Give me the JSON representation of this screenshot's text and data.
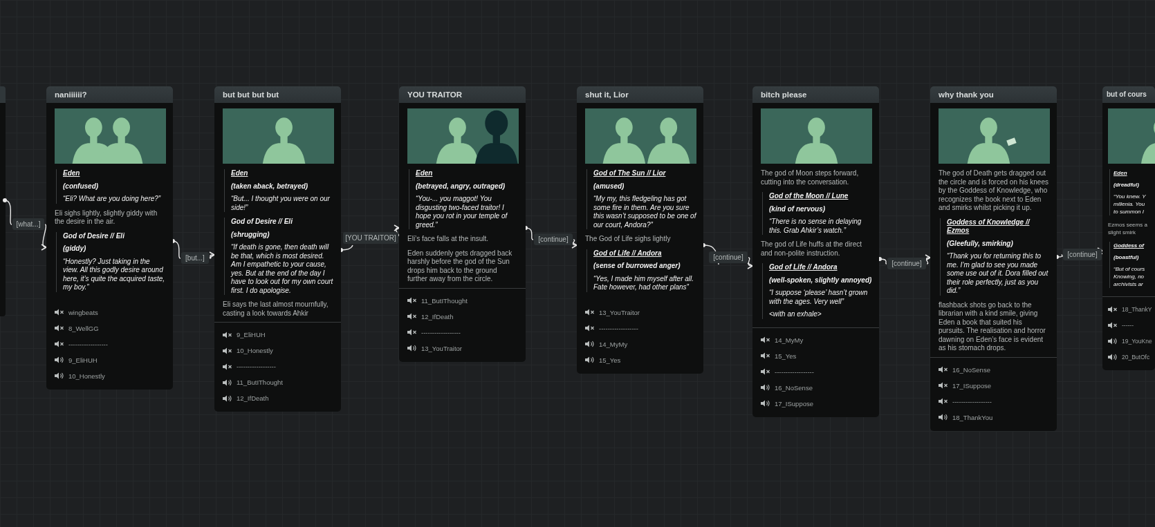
{
  "edges": [
    {
      "label": "[what...]"
    },
    {
      "label": "[but...]"
    },
    {
      "label": "[YOU TRAITOR]"
    },
    {
      "label": "[continue]"
    },
    {
      "label": "[continue]"
    },
    {
      "label": "[continue]"
    },
    {
      "label": "[continue]"
    }
  ],
  "cards": [
    {
      "title": "naniiiiii?",
      "image": {
        "kind": "picture"
      },
      "divider": false,
      "blocks": [
        {
          "kind": "dialogue",
          "speaker": "Eden",
          "underlined": true,
          "emotion": "(confused)",
          "lines": [
            "“Eli? What are you doing here?”"
          ]
        },
        {
          "kind": "narration",
          "lines": [
            "Eli sighs lightly, slightly giddy with the desire in the air."
          ]
        },
        {
          "kind": "dialogue",
          "speaker": "God of Desire // Eli",
          "underlined": false,
          "emotion": "(giddy)",
          "lines": [
            "“Honestly? Just taking in the view. All this godly desire around here, it’s quite the acquired taste, my boy.”"
          ]
        }
      ],
      "audio": [
        {
          "name": "wingbeats",
          "muted": true
        },
        {
          "name": "8_WellGG",
          "muted": true
        },
        {
          "name": "------------------",
          "muted": true
        },
        {
          "name": "9_EliHUH",
          "muted": false
        },
        {
          "name": "10_Honestly",
          "muted": false
        }
      ]
    },
    {
      "title": "but but but but",
      "image": {
        "kind": "picture"
      },
      "divider": true,
      "blocks": [
        {
          "kind": "dialogue",
          "speaker": "Eden",
          "underlined": true,
          "emotion": "(taken aback, betrayed)",
          "lines": [
            "“But... I thought you were on our side!”"
          ]
        },
        {
          "kind": "dialogue",
          "speaker": "God of Desire // Eli",
          "underlined": false,
          "emotion": "(shrugging)",
          "lines": [
            "“If death is gone, then death will be that, which is most desired. Am I empathetic to your cause, yes. But at the end of the day I have to look out for my own court first. I do apologise."
          ]
        },
        {
          "kind": "narration",
          "lines": [
            "Eli says the last almost mournfully, casting a look towards Ahkir"
          ]
        }
      ],
      "audio": [
        {
          "name": "9_EliHUH",
          "muted": true
        },
        {
          "name": "10_Honestly",
          "muted": true
        },
        {
          "name": "------------------",
          "muted": true
        },
        {
          "name": "11_ButIThought",
          "muted": false
        },
        {
          "name": "12_IfDeath",
          "muted": false
        }
      ]
    },
    {
      "title": "YOU TRAITOR",
      "image": {
        "kind": "picture"
      },
      "divider": true,
      "blocks": [
        {
          "kind": "dialogue",
          "speaker": "Eden",
          "underlined": true,
          "emotion": "(betrayed, angry, outraged)",
          "lines": [
            "“You-... you maggot! You disgusting two-faced traitor! I hope you rot in your temple of greed.”"
          ]
        },
        {
          "kind": "narration",
          "lines": [
            "Eli’s face falls at the insult."
          ]
        },
        {
          "kind": "narration",
          "lines": [
            "Eden suddenly gets dragged back harshly before the god of the Sun drops him back to the ground further away from the circle."
          ]
        }
      ],
      "audio": [
        {
          "name": "11_ButIThought",
          "muted": true
        },
        {
          "name": "12_IfDeath",
          "muted": true
        },
        {
          "name": "------------------",
          "muted": true
        },
        {
          "name": "13_YouTraitor",
          "muted": false
        }
      ]
    },
    {
      "title": "shut it, Lior",
      "image": {
        "kind": "picture"
      },
      "divider": false,
      "blocks": [
        {
          "kind": "dialogue",
          "speaker": "God of The Sun // Lior",
          "underlined": true,
          "emotion": "(amused)",
          "lines": [
            "“My my, this fledgeling has got some fire in them. Are you sure this wasn’t supposed to be one of our court, Andora?”"
          ]
        },
        {
          "kind": "narration",
          "lines": [
            "The God of Life sighs lightly"
          ]
        },
        {
          "kind": "dialogue",
          "speaker": "God of Life // Andora",
          "underlined": true,
          "emotion": "(sense of burrowed anger)",
          "lines": [
            "“Yes, I made him myself after all. Fate however, had other plans”"
          ]
        }
      ],
      "audio": [
        {
          "name": "13_YouTraitor",
          "muted": true
        },
        {
          "name": "------------------",
          "muted": true
        },
        {
          "name": "14_MyMy",
          "muted": false
        },
        {
          "name": "15_Yes",
          "muted": false
        }
      ]
    },
    {
      "title": "bitch please",
      "image": {
        "kind": "picture"
      },
      "divider": true,
      "blocks": [
        {
          "kind": "narration",
          "lines": [
            "The god of Moon steps forward, cutting into the conversation."
          ]
        },
        {
          "kind": "dialogue",
          "speaker": "God of the Moon // Lune",
          "underlined": true,
          "emotion": "(kind of nervous)",
          "lines": [
            "“There is no sense in delaying this. Grab Ahkir’s watch.”"
          ]
        },
        {
          "kind": "narration",
          "lines": [
            "The god of Life huffs at the direct and non-polite instruction."
          ]
        },
        {
          "kind": "dialogue",
          "speaker": "God of Life // Andora",
          "underlined": true,
          "emotion": "(well-spoken, slightly annoyed)",
          "lines": [
            "“I suppose ‘please’ hasn’t grown with the ages. Very well”",
            "<with an exhale>"
          ]
        }
      ],
      "audio": [
        {
          "name": "14_MyMy",
          "muted": true
        },
        {
          "name": "15_Yes",
          "muted": true
        },
        {
          "name": "------------------",
          "muted": true
        },
        {
          "name": "16_NoSense",
          "muted": false
        },
        {
          "name": "17_ISuppose",
          "muted": false
        }
      ]
    },
    {
      "title": "why thank you",
      "image": {
        "kind": "picture"
      },
      "divider": true,
      "blocks": [
        {
          "kind": "narration",
          "lines": [
            "The god of Death gets dragged out the circle and is forced on his knees by the Goddess of Knowledge, who recognizes the book next to Eden and smirks whilst picking it up."
          ]
        },
        {
          "kind": "dialogue",
          "speaker": "Goddess of Knowledge // Ezmos",
          "underlined": true,
          "emotion": "(Gleefully, smirking)",
          "lines": [
            "“Thank you for returning this to me. I’m glad to see you made some use out of it. Dora filled out their role perfectly, just as you did.”"
          ]
        },
        {
          "kind": "narration",
          "lines": [
            "flashback shots go back to the librarian with a kind smile, giving Eden a book that suited his pursuits. The realisation and horror dawning on Eden’s face is evident as his stomach drops."
          ]
        }
      ],
      "audio": [
        {
          "name": "16_NoSense",
          "muted": true
        },
        {
          "name": "17_ISuppose",
          "muted": true
        },
        {
          "name": "------------------",
          "muted": true
        },
        {
          "name": "18_ThankYou",
          "muted": false
        }
      ]
    },
    {
      "title": "but of cours",
      "image": {
        "kind": "picture"
      },
      "divider": true,
      "blocks": [
        {
          "kind": "dialogue",
          "speaker": "Eden",
          "underlined": true,
          "emotion": "(dreadful)",
          "lines": [
            "“You knew. Y",
            "millenia. You",
            "to summon I"
          ]
        },
        {
          "kind": "narration",
          "lines": [
            "Ezmos seems a",
            "slight smirk"
          ]
        },
        {
          "kind": "dialogue",
          "speaker": "Goddess of",
          "underlined": true,
          "emotion": "(boastful)",
          "lines": [
            "“But of cours",
            "Knowing, no",
            "archivists ar"
          ]
        }
      ],
      "audio": [
        {
          "name": "18_ThankY",
          "muted": true
        },
        {
          "name": "------",
          "muted": true
        },
        {
          "name": "19_YouKne",
          "muted": false
        },
        {
          "name": "20_ButOfc",
          "muted": false
        }
      ]
    }
  ]
}
